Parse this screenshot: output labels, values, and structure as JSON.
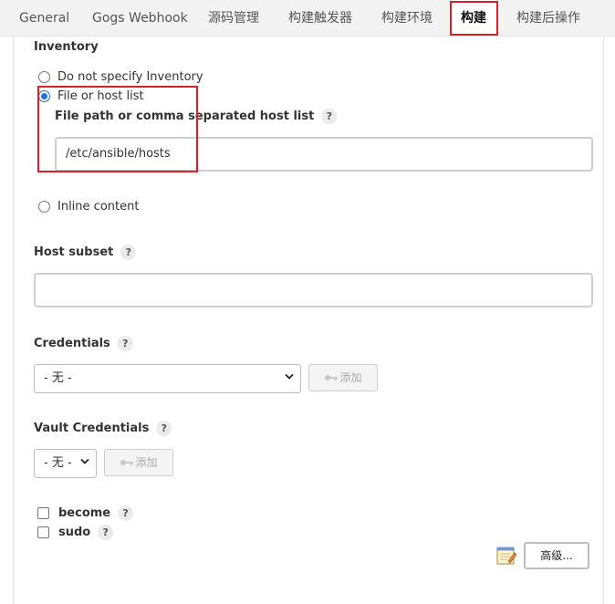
{
  "tabs": [
    {
      "label": "General"
    },
    {
      "label": "Gogs Webhook"
    },
    {
      "label": "源码管理"
    },
    {
      "label": "构建触发器"
    },
    {
      "label": "构建环境"
    },
    {
      "label": "构建"
    },
    {
      "label": "构建后操作"
    }
  ],
  "active_tab": "构建",
  "inventory": {
    "title": "Inventory",
    "options": [
      {
        "label": "Do not specify Inventory",
        "selected": false
      },
      {
        "label": "File or host list",
        "selected": true
      },
      {
        "label": "Inline content",
        "selected": false
      }
    ],
    "file_path_label": "File path or comma separated host list",
    "file_path_value": "/etc/ansible/hosts"
  },
  "host_subset": {
    "label": "Host subset",
    "value": ""
  },
  "credentials": {
    "label": "Credentials",
    "selected": "- 无 -",
    "add_label": "添加"
  },
  "vault_credentials": {
    "label": "Vault Credentials",
    "selected": "- 无 -",
    "add_label": "添加"
  },
  "options": {
    "become_label": "become",
    "sudo_label": "sudo"
  },
  "advanced_button": "高级...",
  "help_glyph": "?",
  "colors": {
    "highlight": "#d9202a",
    "radio_selected": "#1a73e8"
  }
}
